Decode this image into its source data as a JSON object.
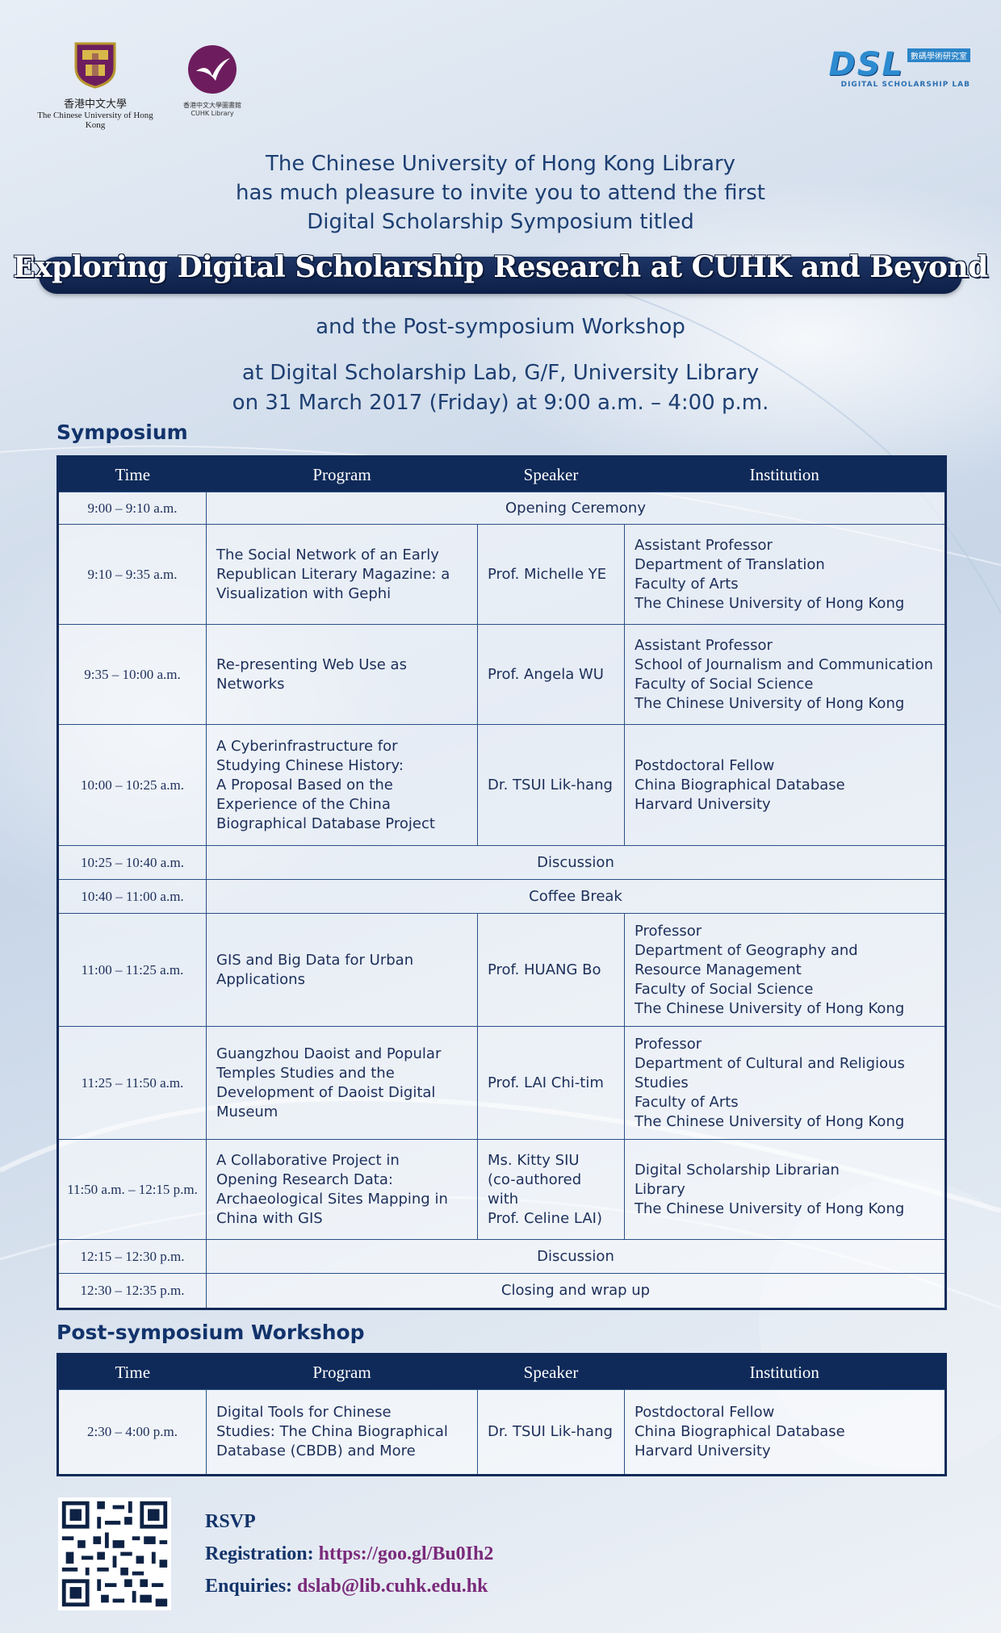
{
  "logos": {
    "cuhk_zh": "香港中文大學",
    "cuhk_en": "The Chinese University of Hong Kong",
    "library_zh": "香港中文大學圖書館",
    "library_en": "CUHK Library",
    "dsl_mark": "DSL",
    "dsl_zh": "數碼學術研究室",
    "dsl_en": "DIGITAL SCHOLARSHIP LAB"
  },
  "intro": {
    "line1": "The Chinese University of Hong Kong Library",
    "line2": "has much pleasure to invite you to attend the first",
    "line3": "Digital Scholarship Symposium titled"
  },
  "title": "Exploring Digital Scholarship Research at CUHK and Beyond",
  "subtitle": "and the Post-symposium Workshop",
  "venue": {
    "line1": "at Digital Scholarship Lab, G/F, University Library",
    "line2": "on 31 March 2017 (Friday) at 9:00 a.m. – 4:00 p.m."
  },
  "symposium": {
    "heading": "Symposium",
    "headers": [
      "Time",
      "Program",
      "Speaker",
      "Institution"
    ],
    "rows": [
      {
        "time": "9:00 – 9:10 a.m.",
        "span": "Opening Ceremony"
      },
      {
        "time": "9:10 – 9:35 a.m.",
        "program": [
          "The Social Network of an Early",
          "Republican Literary Magazine: a",
          "Visualization with Gephi"
        ],
        "speaker": [
          "Prof. Michelle YE"
        ],
        "institution": [
          "Assistant Professor",
          "Department of Translation",
          "Faculty of Arts",
          "The Chinese University of Hong Kong"
        ]
      },
      {
        "time": "9:35 – 10:00 a.m.",
        "program": [
          "Re-presenting Web Use as",
          "Networks"
        ],
        "speaker": [
          "Prof. Angela WU"
        ],
        "institution": [
          "Assistant Professor",
          "School of Journalism and Communication",
          "Faculty of Social Science",
          "The Chinese University of Hong Kong"
        ]
      },
      {
        "time": "10:00 – 10:25 a.m.",
        "program": [
          "A Cyberinfrastructure for",
          "Studying Chinese History:",
          "A Proposal Based on the",
          "Experience of the China",
          "Biographical Database Project"
        ],
        "speaker": [
          "Dr. TSUI Lik-hang"
        ],
        "institution": [
          "Postdoctoral Fellow",
          "China Biographical Database",
          "Harvard University"
        ]
      },
      {
        "time": "10:25 – 10:40 a.m.",
        "span": "Discussion"
      },
      {
        "time": "10:40 – 11:00 a.m.",
        "span": "Coffee Break"
      },
      {
        "time": "11:00 – 11:25 a.m.",
        "program": [
          "GIS and Big Data for Urban",
          "Applications"
        ],
        "speaker": [
          "Prof. HUANG Bo"
        ],
        "institution": [
          "Professor",
          "Department of Geography and",
          "Resource Management",
          "Faculty of Social Science",
          "The Chinese University of Hong Kong"
        ]
      },
      {
        "time": "11:25 – 11:50 a.m.",
        "program": [
          "Guangzhou Daoist and Popular",
          "Temples Studies and the",
          "Development of Daoist Digital",
          "Museum"
        ],
        "speaker": [
          "Prof. LAI Chi-tim"
        ],
        "institution": [
          "Professor",
          "Department of Cultural and Religious",
          "Studies",
          "Faculty of Arts",
          "The Chinese University of Hong Kong"
        ]
      },
      {
        "time": "11:50 a.m. – 12:15 p.m.",
        "program": [
          "A Collaborative Project in",
          "Opening Research Data:",
          "Archaeological Sites Mapping in",
          "China with GIS"
        ],
        "speaker": [
          "Ms. Kitty SIU",
          "(co-authored with",
          "Prof. Celine LAI)"
        ],
        "institution": [
          "Digital Scholarship Librarian",
          "Library",
          "The Chinese University of Hong Kong"
        ]
      },
      {
        "time": "12:15 – 12:30 p.m.",
        "span": "Discussion"
      },
      {
        "time": "12:30 – 12:35 p.m.",
        "span": "Closing and wrap up"
      }
    ]
  },
  "workshop": {
    "heading": "Post-symposium Workshop",
    "headers": [
      "Time",
      "Program",
      "Speaker",
      "Institution"
    ],
    "rows": [
      {
        "time": "2:30 – 4:00 p.m.",
        "program": [
          "Digital Tools for Chinese",
          "Studies: The China Biographical",
          "Database (CBDB) and More"
        ],
        "speaker": [
          "Dr. TSUI Lik-hang"
        ],
        "institution": [
          "Postdoctoral Fellow",
          "China Biographical Database",
          "Harvard University"
        ]
      }
    ]
  },
  "rsvp": {
    "heading": "RSVP",
    "registration_label": "Registration:",
    "registration_link": "https://goo.gl/Bu0Ih2",
    "enquiries_label": "Enquiries:",
    "enquiries_email": "dslab@lib.cuhk.edu.hk"
  },
  "colors": {
    "navy": "#0f2a59",
    "text": "#1d3f72",
    "link": "#7a2a7a"
  }
}
